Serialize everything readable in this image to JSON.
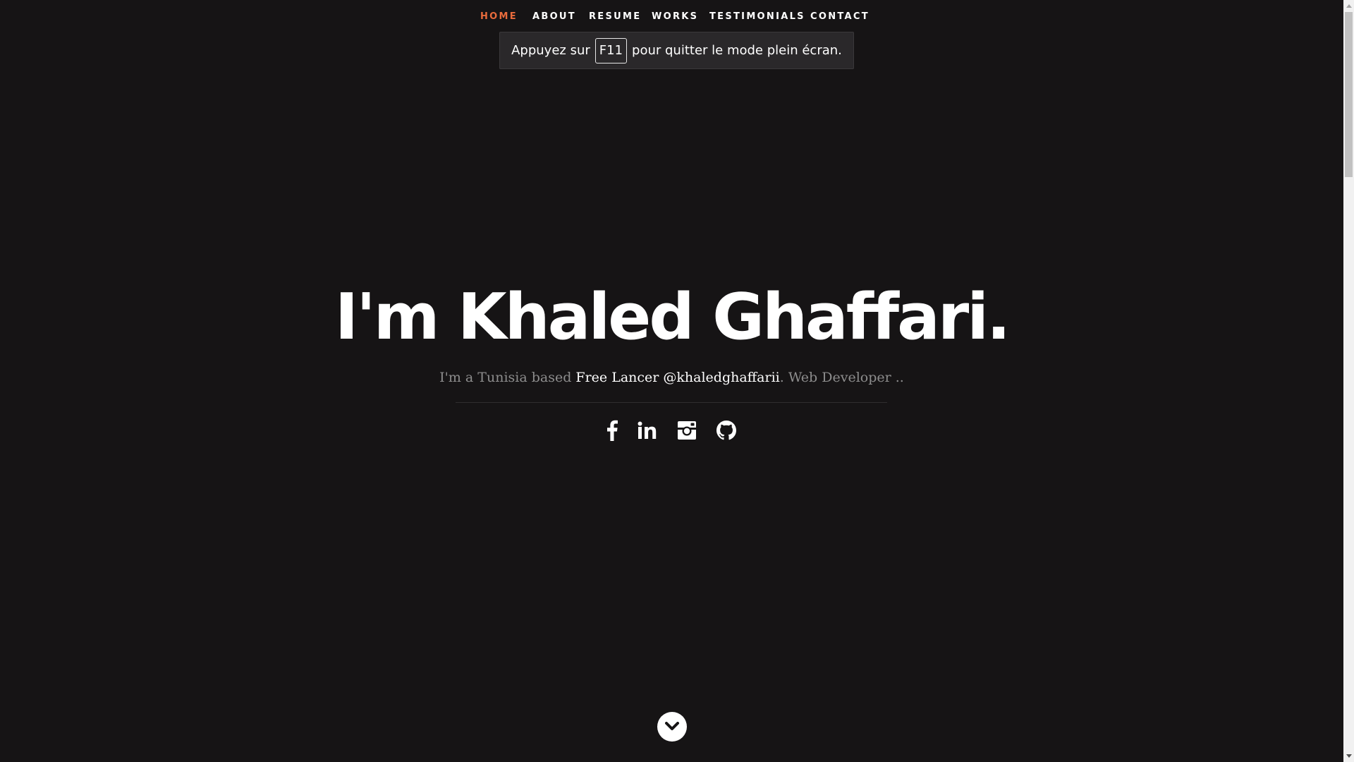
{
  "nav": {
    "items": [
      {
        "label": "HOME",
        "active": true
      },
      {
        "label": "ABOUT",
        "active": false
      },
      {
        "label": "RESUME",
        "active": false
      },
      {
        "label": "WORKS",
        "active": false
      },
      {
        "label": "TESTIMONIALS",
        "active": false
      },
      {
        "label": "CONTACT",
        "active": false
      }
    ],
    "active_color": "#e86b3c"
  },
  "fullscreen_notice": {
    "before": "Appuyez sur",
    "key": "F11",
    "after": "pour quitter le mode plein écran."
  },
  "hero": {
    "title": "I'm Khaled Ghaffari.",
    "subtitle_prefix": "I'm a Tunisia based ",
    "subtitle_highlight": "Free Lancer @khaledghaffarii",
    "subtitle_suffix": ". Web Developer .."
  },
  "social": [
    {
      "icon": "facebook-icon"
    },
    {
      "icon": "linkedin-icon"
    },
    {
      "icon": "instagram-icon"
    },
    {
      "icon": "github-icon"
    }
  ],
  "scroll_down": {
    "icon": "chevron-down-icon"
  },
  "colors": {
    "background": "#161415",
    "text": "#ffffff",
    "muted_text": "#8d8d8d",
    "accent": "#e86b3c"
  }
}
